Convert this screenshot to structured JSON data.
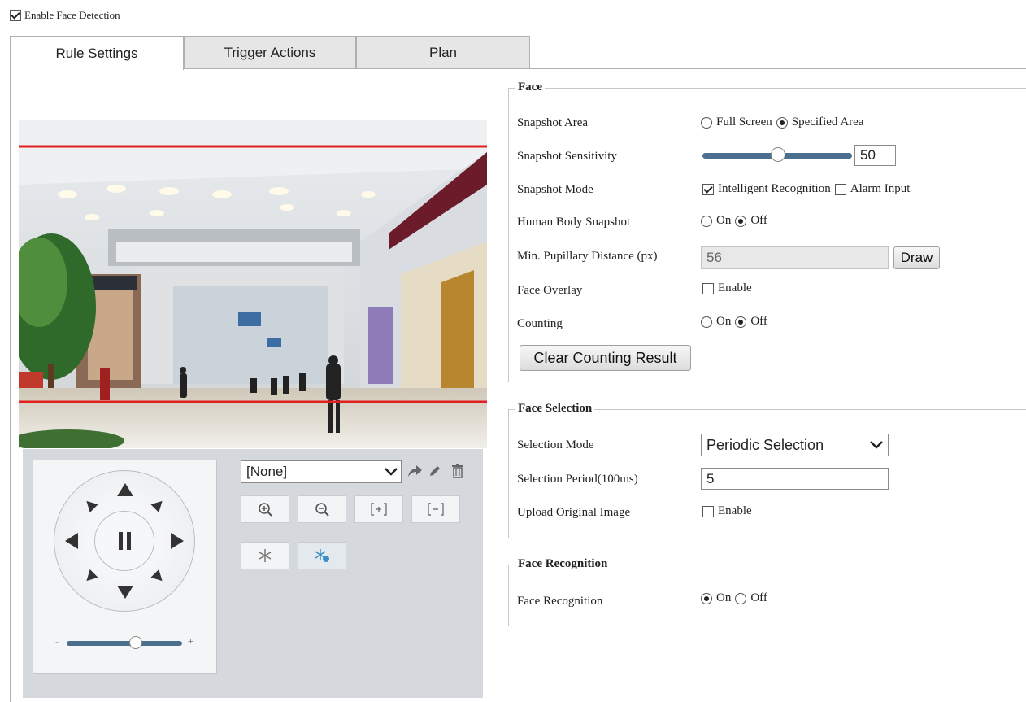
{
  "enable": {
    "label": "Enable Face Detection",
    "checked": true
  },
  "tabs": [
    {
      "label": "Rule Settings",
      "active": true
    },
    {
      "label": "Trigger Actions",
      "active": false
    },
    {
      "label": "Plan",
      "active": false
    }
  ],
  "ptz": {
    "preset_value": "[None]",
    "zoom_in_icon": "zoom-in-icon",
    "zoom_out_icon": "zoom-out-icon",
    "focus_near_icon": "focus-near-icon",
    "focus_far_icon": "focus-far-icon",
    "speed_level": 0.6
  },
  "face": {
    "legend": "Face",
    "snapshot_area": {
      "label": "Snapshot Area",
      "options": [
        "Full Screen",
        "Specified Area"
      ],
      "selected": 1
    },
    "snapshot_sensitivity": {
      "label": "Snapshot Sensitivity",
      "value": "50"
    },
    "snapshot_mode": {
      "label": "Snapshot Mode",
      "intelligent": "Intelligent Recognition",
      "intelligent_checked": true,
      "alarm": "Alarm Input",
      "alarm_checked": false
    },
    "human_body": {
      "label": "Human Body Snapshot",
      "on": "On",
      "off": "Off",
      "selected": "off"
    },
    "pupillary": {
      "label": "Min. Pupillary Distance (px)",
      "value": "56",
      "draw_label": "Draw"
    },
    "overlay": {
      "label": "Face Overlay",
      "option": "Enable",
      "checked": false
    },
    "counting": {
      "label": "Counting",
      "on": "On",
      "off": "Off",
      "selected": "off"
    },
    "clear_label": "Clear Counting Result"
  },
  "selection": {
    "legend": "Face Selection",
    "mode": {
      "label": "Selection Mode",
      "value": "Periodic Selection"
    },
    "period": {
      "label": "Selection Period(100ms)",
      "value": "5"
    },
    "upload": {
      "label": "Upload Original Image",
      "option": "Enable",
      "checked": false
    }
  },
  "recognition": {
    "legend": "Face Recognition",
    "row": {
      "label": "Face Recognition",
      "on": "On",
      "off": "Off",
      "selected": "on"
    }
  },
  "colors": {
    "accent": "#4a6f8f",
    "rule_line": "#e02020",
    "panel": "#d5d9de"
  }
}
